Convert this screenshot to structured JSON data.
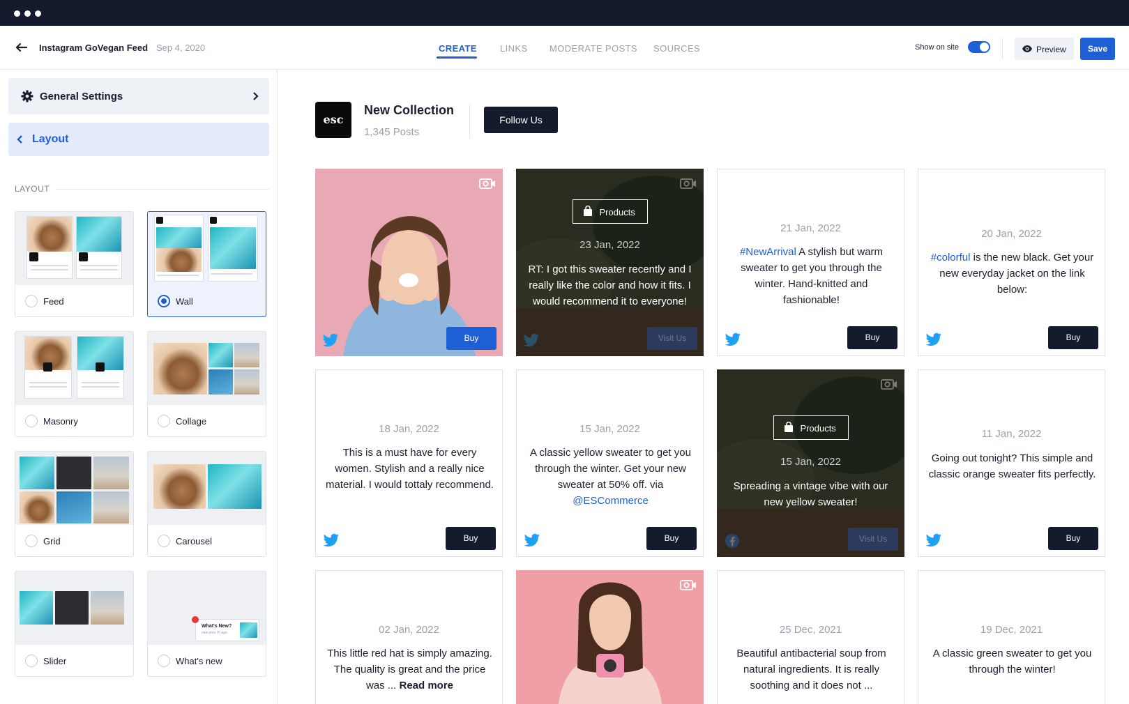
{
  "header": {
    "feed_title": "Instagram GoVegan Feed",
    "feed_date": "Sep 4, 2020",
    "tabs": [
      {
        "label": "CREATE",
        "active": true
      },
      {
        "label": "LINKS",
        "active": false
      },
      {
        "label": "MODERATE POSTS",
        "active": false
      },
      {
        "label": "SOURCES",
        "active": false
      }
    ],
    "show_on_site_label": "Show on site",
    "show_on_site": true,
    "preview_label": "Preview",
    "save_label": "Save"
  },
  "sidebar": {
    "general_settings_label": "General Settings",
    "layout_label": "Layout",
    "section_label": "LAYOUT",
    "layouts": [
      {
        "name": "Feed",
        "selected": false
      },
      {
        "name": "Wall",
        "selected": true
      },
      {
        "name": "Masonry",
        "selected": false
      },
      {
        "name": "Collage",
        "selected": false
      },
      {
        "name": "Grid",
        "selected": false
      },
      {
        "name": "Carousel",
        "selected": false
      },
      {
        "name": "Slider",
        "selected": false
      },
      {
        "name": "What's new",
        "selected": false
      }
    ],
    "whats_new_thumb_title": "What's New?",
    "whats_new_thumb_sub": "new post 7h ago"
  },
  "profile": {
    "logo_text": "esc",
    "name": "New Collection",
    "posts": "1,345 Posts",
    "follow_label": "Follow Us"
  },
  "posts": [
    {
      "buy_label": "Buy",
      "network": "twitter-icon"
    },
    {
      "products_label": "Products",
      "date": "23 Jan, 2022",
      "text": "RT: I got this sweater recently and I really like the color and how it fits. I would recommend it to everyone!",
      "visit_label": "Visit Us",
      "network": "twitter-icon"
    },
    {
      "date": "21 Jan, 2022",
      "hashtag": "#NewArrival",
      "text": " A stylish but warm sweater to get you through the winter. Hand-knitted and fashionable!",
      "buy_label": "Buy",
      "network": "twitter-icon"
    },
    {
      "date": "20 Jan, 2022",
      "hashtag": "#colorful",
      "text": " is the new black. Get your new everyday jacket on the link below:",
      "buy_label": "Buy",
      "network": "twitter-icon"
    },
    {
      "date": "18 Jan, 2022",
      "text": "This is a must have for every women. Stylish and a really nice material. I would tottaly recommend.",
      "buy_label": "Buy",
      "network": "twitter-icon"
    },
    {
      "date": "15 Jan, 2022",
      "text": "A classic yellow sweater to get you through the winter. Get your new sweater at 50% off. via ",
      "mention": "@ESCommerce",
      "buy_label": "Buy",
      "network": "twitter-icon"
    },
    {
      "products_label": "Products",
      "date": "15 Jan, 2022",
      "text": "Spreading a vintage vibe with our new yellow sweater!",
      "visit_label": "Visit Us",
      "network": "facebook-icon"
    },
    {
      "date": "11 Jan, 2022",
      "text": "Going out tonight? This simple and classic orange sweater fits perfectly.",
      "buy_label": "Buy",
      "network": "twitter-icon"
    },
    {
      "date": "02 Jan, 2022",
      "text": "This little red hat is simply amazing. The quality is great and the price was  ...",
      "read_more": "Read more"
    },
    {
      "network": "camera-icon"
    },
    {
      "date": "25 Dec, 2021",
      "text": "Beautiful antibacterial soup from natural ingredients. It is really soothing and it does not ..."
    },
    {
      "date": "19 Dec, 2021",
      "text": "A classic green sweater to get you through the winter!"
    }
  ]
}
